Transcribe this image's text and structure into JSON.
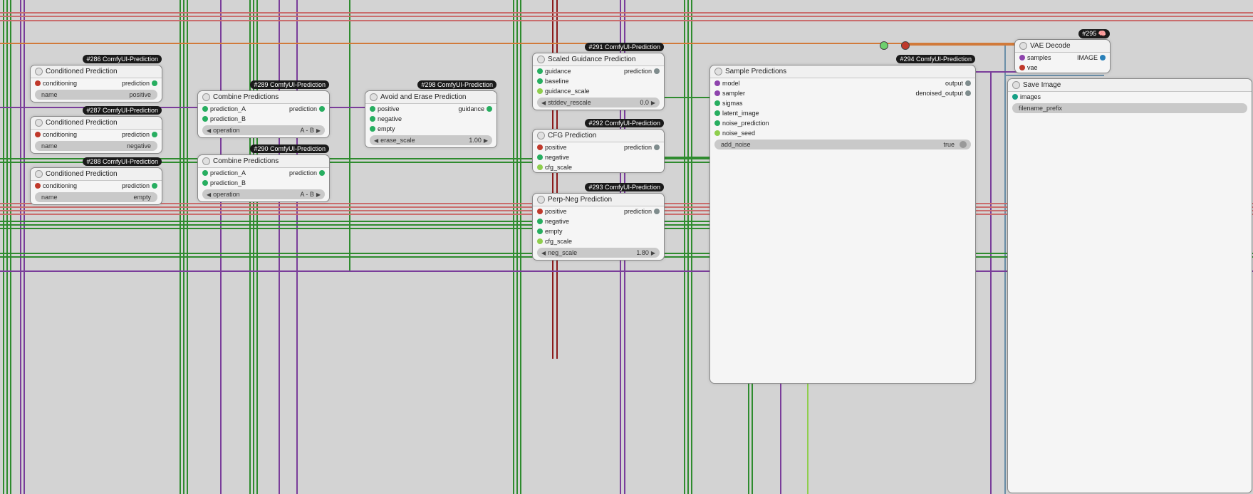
{
  "nodes": {
    "n286": {
      "badge": "#286 ComfyUI-Prediction",
      "title": "Conditioned Prediction",
      "inputs": [
        {
          "name": "conditioning",
          "color": "p-red"
        }
      ],
      "outputs": [
        {
          "name": "prediction",
          "color": "p-green"
        }
      ],
      "widget": {
        "label": "name",
        "value": "positive"
      }
    },
    "n287": {
      "badge": "#287 ComfyUI-Prediction",
      "title": "Conditioned Prediction",
      "inputs": [
        {
          "name": "conditioning",
          "color": "p-red"
        }
      ],
      "outputs": [
        {
          "name": "prediction",
          "color": "p-green"
        }
      ],
      "widget": {
        "label": "name",
        "value": "negative"
      }
    },
    "n288": {
      "badge": "#288 ComfyUI-Prediction",
      "title": "Conditioned Prediction",
      "inputs": [
        {
          "name": "conditioning",
          "color": "p-red"
        }
      ],
      "outputs": [
        {
          "name": "prediction",
          "color": "p-green"
        }
      ],
      "widget": {
        "label": "name",
        "value": "empty"
      }
    },
    "n289": {
      "badge": "#289 ComfyUI-Prediction",
      "title": "Combine Predictions",
      "inputs": [
        {
          "name": "prediction_A",
          "color": "p-green"
        },
        {
          "name": "prediction_B",
          "color": "p-green"
        }
      ],
      "outputs": [
        {
          "name": "prediction",
          "color": "p-green"
        }
      ],
      "widget": {
        "label": "operation",
        "value": "A - B"
      }
    },
    "n290": {
      "badge": "#290 ComfyUI-Prediction",
      "title": "Combine Predictions",
      "inputs": [
        {
          "name": "prediction_A",
          "color": "p-green"
        },
        {
          "name": "prediction_B",
          "color": "p-green"
        }
      ],
      "outputs": [
        {
          "name": "prediction",
          "color": "p-green"
        }
      ],
      "widget": {
        "label": "operation",
        "value": "A - B"
      }
    },
    "n298": {
      "badge": "#298 ComfyUI-Prediction",
      "title": "Avoid and Erase Prediction",
      "inputs": [
        {
          "name": "positive",
          "color": "p-green"
        },
        {
          "name": "negative",
          "color": "p-green"
        },
        {
          "name": "empty",
          "color": "p-green"
        }
      ],
      "outputs": [
        {
          "name": "guidance",
          "color": "p-green"
        }
      ],
      "widget": {
        "label": "erase_scale",
        "value": "1.00"
      }
    },
    "n291": {
      "badge": "#291 ComfyUI-Prediction",
      "title": "Scaled Guidance Prediction",
      "inputs": [
        {
          "name": "guidance",
          "color": "p-green"
        },
        {
          "name": "baseline",
          "color": "p-green"
        },
        {
          "name": "guidance_scale",
          "color": "p-lime"
        }
      ],
      "outputs": [
        {
          "name": "prediction",
          "color": "p-gray"
        }
      ],
      "widget": {
        "label": "stddev_rescale",
        "value": "0.0"
      }
    },
    "n292": {
      "badge": "#292 ComfyUI-Prediction",
      "title": "CFG Prediction",
      "inputs": [
        {
          "name": "positive",
          "color": "p-red"
        },
        {
          "name": "negative",
          "color": "p-green"
        },
        {
          "name": "cfg_scale",
          "color": "p-lime"
        }
      ],
      "outputs": [
        {
          "name": "prediction",
          "color": "p-gray"
        }
      ]
    },
    "n293": {
      "badge": "#293 ComfyUI-Prediction",
      "title": "Perp-Neg Prediction",
      "inputs": [
        {
          "name": "positive",
          "color": "p-red"
        },
        {
          "name": "negative",
          "color": "p-green"
        },
        {
          "name": "empty",
          "color": "p-green"
        },
        {
          "name": "cfg_scale",
          "color": "p-lime"
        }
      ],
      "outputs": [
        {
          "name": "prediction",
          "color": "p-gray"
        }
      ],
      "widget": {
        "label": "neg_scale",
        "value": "1.80"
      }
    },
    "n294": {
      "badge": "#294 ComfyUI-Prediction",
      "title": "Sample Predictions",
      "inputs": [
        {
          "name": "model",
          "color": "p-purple"
        },
        {
          "name": "sampler",
          "color": "p-purple"
        },
        {
          "name": "sigmas",
          "color": "p-green"
        },
        {
          "name": "latent_image",
          "color": "p-green"
        },
        {
          "name": "noise_prediction",
          "color": "p-green"
        },
        {
          "name": "noise_seed",
          "color": "p-lime"
        }
      ],
      "outputs": [
        {
          "name": "output",
          "color": "p-gray"
        },
        {
          "name": "denoised_output",
          "color": "p-gray"
        }
      ],
      "widget": {
        "label": "add_noise",
        "value": "true"
      }
    },
    "n295": {
      "badge": "#295",
      "title": "VAE Decode",
      "inputs": [
        {
          "name": "samples",
          "color": "p-purple"
        },
        {
          "name": "vae",
          "color": "p-red"
        }
      ],
      "outputs": [
        {
          "name": "IMAGE",
          "color": "p-blue"
        }
      ]
    },
    "n296": {
      "title": "Save Image",
      "inputs": [
        {
          "name": "images",
          "color": "p-cyan"
        }
      ],
      "widget": {
        "label": "filename_prefix",
        "value": ""
      }
    }
  }
}
